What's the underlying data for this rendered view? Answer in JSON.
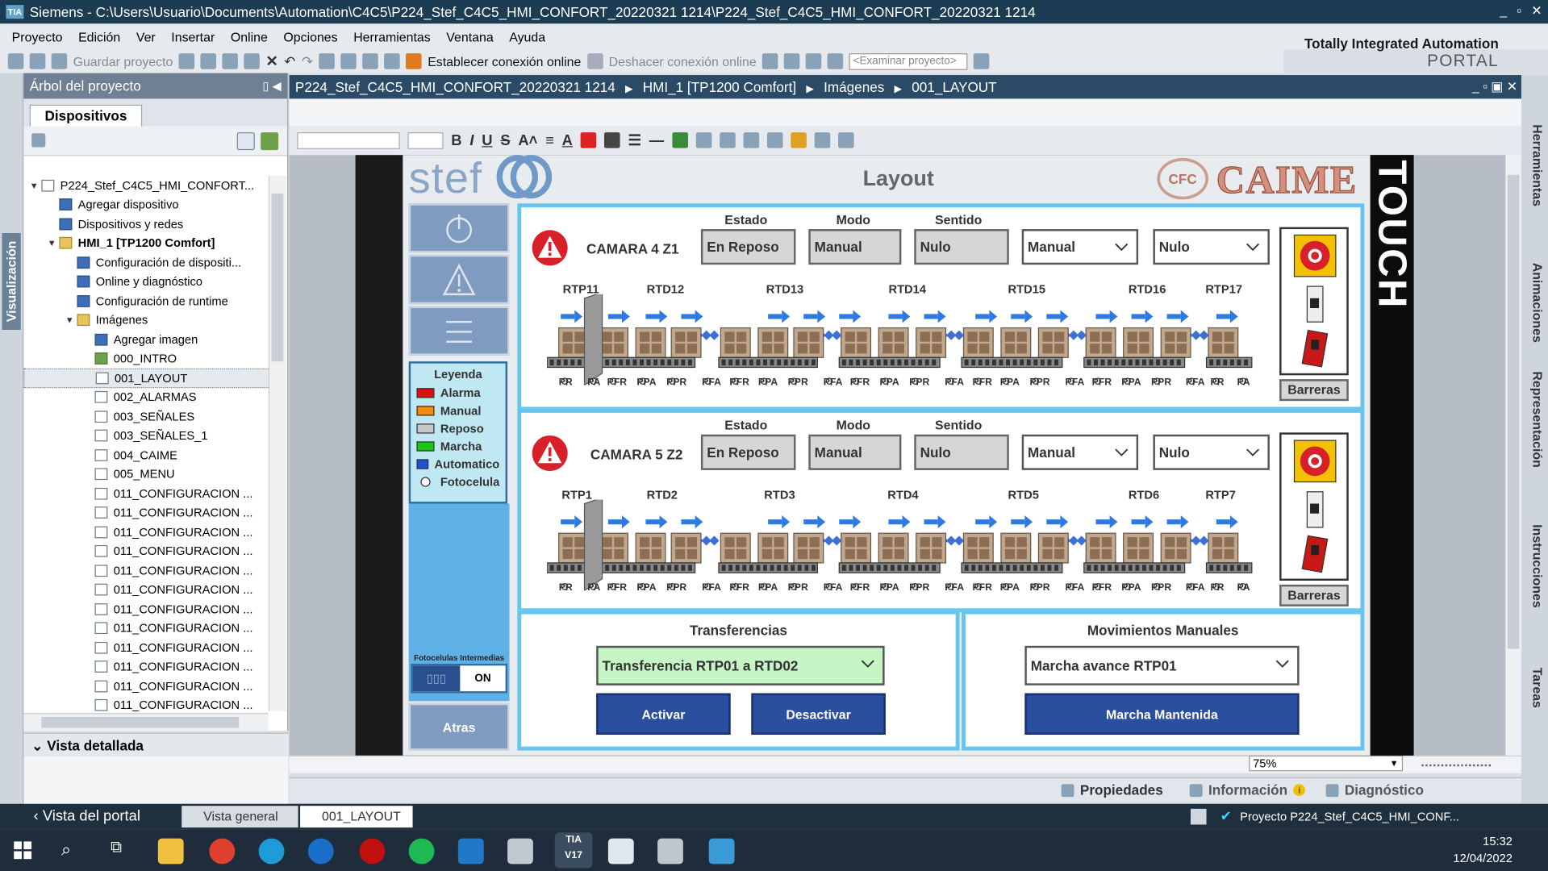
{
  "window": {
    "title": "Siemens  -  C:\\Users\\Usuario\\Documents\\Automation\\C4C5\\P224_Stef_C4C5_HMI_CONFORT_20220321 1214\\P224_Stef_C4C5_HMI_CONFORT_20220321 1214"
  },
  "menu": [
    "Proyecto",
    "Edición",
    "Ver",
    "Insertar",
    "Online",
    "Opciones",
    "Herramientas",
    "Ventana",
    "Ayuda"
  ],
  "brand": {
    "line1": "Totally Integrated Automation",
    "line2": "PORTAL"
  },
  "toolbar": {
    "save_label": "Guardar proyecto",
    "connect_online": "Establecer conexión online",
    "disconnect_online": "Deshacer conexión online",
    "search_placeholder": "<Examinar proyecto>"
  },
  "left_strip": {
    "label": "Visualización"
  },
  "project_tree": {
    "header": "Árbol del proyecto",
    "tab": "Dispositivos",
    "items": [
      {
        "label": "P224_Stef_C4C5_HMI_CONFORT...",
        "level": 0,
        "arrow": "▼",
        "icon": "project"
      },
      {
        "label": "Agregar dispositivo",
        "level": 1,
        "arrow": "",
        "icon": "add"
      },
      {
        "label": "Dispositivos y redes",
        "level": 1,
        "arrow": "",
        "icon": "network"
      },
      {
        "label": "HMI_1 [TP1200 Comfort]",
        "level": 1,
        "arrow": "▼",
        "icon": "hmi",
        "bold": true
      },
      {
        "label": "Configuración de dispositi...",
        "level": 2,
        "arrow": "",
        "icon": "config"
      },
      {
        "label": "Online y diagnóstico",
        "level": 2,
        "arrow": "",
        "icon": "online"
      },
      {
        "label": "Configuración de runtime",
        "level": 2,
        "arrow": "",
        "icon": "runtime"
      },
      {
        "label": "Imágenes",
        "level": 2,
        "arrow": "▼",
        "icon": "folder"
      },
      {
        "label": "Agregar imagen",
        "level": 3,
        "arrow": "",
        "icon": "add"
      },
      {
        "label": "000_INTRO",
        "level": 3,
        "arrow": "",
        "icon": "screen-start"
      },
      {
        "label": "001_LAYOUT",
        "level": 3,
        "arrow": "",
        "icon": "screen",
        "selected": true
      },
      {
        "label": "002_ALARMAS",
        "level": 3,
        "arrow": "",
        "icon": "screen"
      },
      {
        "label": "003_SEÑALES",
        "level": 3,
        "arrow": "",
        "icon": "screen"
      },
      {
        "label": "003_SEÑALES_1",
        "level": 3,
        "arrow": "",
        "icon": "screen"
      },
      {
        "label": "004_CAIME",
        "level": 3,
        "arrow": "",
        "icon": "screen"
      },
      {
        "label": "005_MENU",
        "level": 3,
        "arrow": "",
        "icon": "screen"
      },
      {
        "label": "011_CONFIGURACION ...",
        "level": 3,
        "arrow": "",
        "icon": "screen"
      },
      {
        "label": "011_CONFIGURACION ...",
        "level": 3,
        "arrow": "",
        "icon": "screen"
      },
      {
        "label": "011_CONFIGURACION ...",
        "level": 3,
        "arrow": "",
        "icon": "screen"
      },
      {
        "label": "011_CONFIGURACION ...",
        "level": 3,
        "arrow": "",
        "icon": "screen"
      },
      {
        "label": "011_CONFIGURACION ...",
        "level": 3,
        "arrow": "",
        "icon": "screen"
      },
      {
        "label": "011_CONFIGURACION ...",
        "level": 3,
        "arrow": "",
        "icon": "screen"
      },
      {
        "label": "011_CONFIGURACION ...",
        "level": 3,
        "arrow": "",
        "icon": "screen"
      },
      {
        "label": "011_CONFIGURACION ...",
        "level": 3,
        "arrow": "",
        "icon": "screen"
      },
      {
        "label": "011_CONFIGURACION ...",
        "level": 3,
        "arrow": "",
        "icon": "screen"
      },
      {
        "label": "011_CONFIGURACION ...",
        "level": 3,
        "arrow": "",
        "icon": "screen"
      },
      {
        "label": "011_CONFIGURACION ...",
        "level": 3,
        "arrow": "",
        "icon": "screen"
      },
      {
        "label": "011_CONFIGURACION ...",
        "level": 3,
        "arrow": "",
        "icon": "screen"
      }
    ],
    "detail_view": "Vista detallada"
  },
  "editor": {
    "breadcrumb": [
      "P224_Stef_C4C5_HMI_CONFORT_20220321 1214",
      "HMI_1 [TP1200 Comfort]",
      "Imágenes",
      "001_LAYOUT"
    ],
    "zoom": "75%"
  },
  "right_tabs": [
    "Herramientas",
    "Animaciones",
    "Representación",
    "Instrucciones",
    "Tareas"
  ],
  "hmi": {
    "logo_left": "stef",
    "title": "Layout",
    "logo_right_mark": "CFC",
    "logo_right": "CAIME",
    "touch": "TOUCH",
    "legend": {
      "title": "Leyenda",
      "items": [
        {
          "label": "Alarma",
          "color": "#e01010"
        },
        {
          "label": "Manual",
          "color": "#f08a10"
        },
        {
          "label": "Reposo",
          "color": "#c8c8c8"
        },
        {
          "label": "Marcha",
          "color": "#18c818"
        },
        {
          "label": "Automatico",
          "color": "#1e50d8"
        },
        {
          "label": "Fotocelula",
          "color": "circle"
        }
      ]
    },
    "fotocelulas_label": "Fotocelulas Intermedias",
    "toggle_on": "ON",
    "atras": "Atras",
    "col_labels": {
      "estado": "Estado",
      "modo": "Modo",
      "sentido": "Sentido"
    },
    "cameras": [
      {
        "name": "CAMARA 4 Z1",
        "estado": "En Reposo",
        "modo": "Manual",
        "sentido": "Nulo",
        "dd_modo": "Manual",
        "dd_sentido": "Nulo",
        "stations": [
          "RTP11",
          "RTD12",
          "RTD13",
          "RTD14",
          "RTD15",
          "RTD16",
          "RTP17"
        ],
        "sensors": [
          "PR",
          "PA",
          "PFR",
          "PPA",
          "PPR",
          "PFA",
          "PFR",
          "PPA",
          "PPR",
          "PFA",
          "PFR",
          "PPA",
          "PPR",
          "PFA",
          "PFR",
          "PPA",
          "PPR",
          "PFA",
          "PFR",
          "PPA",
          "PPR",
          "PFA",
          "PR",
          "PA"
        ],
        "barreras": "Barreras"
      },
      {
        "name": "CAMARA 5 Z2",
        "estado": "En Reposo",
        "modo": "Manual",
        "sentido": "Nulo",
        "dd_modo": "Manual",
        "dd_sentido": "Nulo",
        "stations": [
          "RTP1",
          "RTD2",
          "RTD3",
          "RTD4",
          "RTD5",
          "RTD6",
          "RTP7"
        ],
        "sensors": [
          "PR",
          "PA",
          "PFR",
          "PPA",
          "PPR",
          "PFA",
          "PFR",
          "PPA",
          "PPR",
          "PFA",
          "PFR",
          "PPA",
          "PPR",
          "PFA",
          "PFR",
          "PPA",
          "PPR",
          "PFA",
          "PFR",
          "PPA",
          "PPR",
          "PFA",
          "PR",
          "PA"
        ],
        "barreras": "Barreras"
      }
    ],
    "transferencias": {
      "title": "Transferencias",
      "selected": "Transferencia RTP01 a RTD02",
      "activar": "Activar",
      "desactivar": "Desactivar"
    },
    "manuales": {
      "title": "Movimientos Manuales",
      "selected": "Marcha avance RTP01",
      "marcha": "Marcha Mantenida"
    }
  },
  "inspector": {
    "propiedades": "Propiedades",
    "informacion": "Información",
    "diagnostico": "Diagnóstico"
  },
  "portal": {
    "portal_view": "Vista del portal",
    "overview": "Vista general",
    "open_editor": "001_LAYOUT",
    "status": "Proyecto P224_Stef_C4C5_HMI_CONF..."
  },
  "taskbar": {
    "time": "15:32",
    "date": "12/04/2022"
  }
}
